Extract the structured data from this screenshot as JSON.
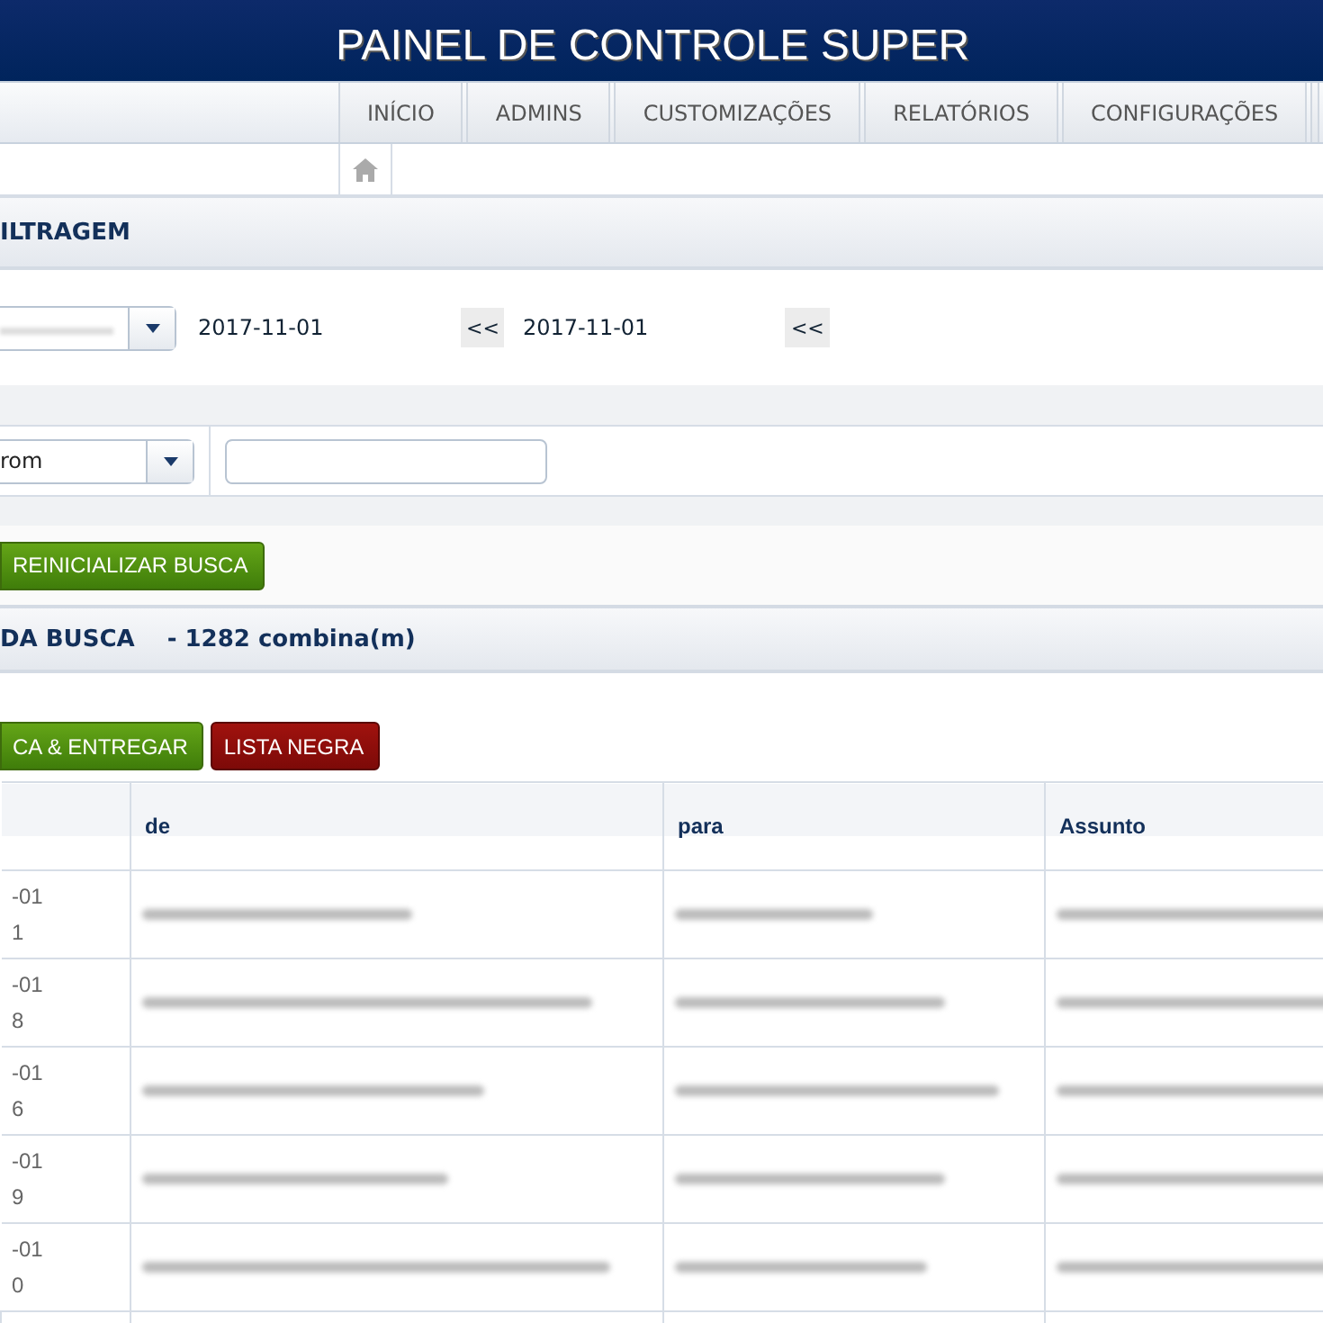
{
  "header": {
    "title": "PAINEL DE CONTROLE SUPER"
  },
  "nav": {
    "tabs": [
      {
        "label": "INÍCIO",
        "selected": false
      },
      {
        "label": "ADMINS",
        "selected": false
      },
      {
        "label": "CUSTOMIZAÇÕES",
        "selected": false
      },
      {
        "label": "RELATÓRIOS",
        "selected": false
      },
      {
        "label": "CONFIGURAÇÕES",
        "selected": false
      }
    ]
  },
  "filter": {
    "title": "ILTRAGEM",
    "date_from": "2017-11-01",
    "date_to": "2017-11-01",
    "prev_button": "<<",
    "field_select": "rom"
  },
  "reset_button": "REINICIALIZAR BUSCA",
  "results": {
    "title": "DA BUSCA",
    "count": "- 1282 combina(m)"
  },
  "actions": [
    {
      "label": "CA & ENTREGAR",
      "kind": "release"
    },
    {
      "label": "LISTA NEGRA",
      "kind": "blacklist"
    }
  ],
  "table": {
    "columns": [
      "",
      "de",
      "para",
      "Assunto"
    ],
    "rows": [
      {
        "date": "-01",
        "time": "1"
      },
      {
        "date": "-01",
        "time": "8"
      },
      {
        "date": "-01",
        "time": "6"
      },
      {
        "date": "-01",
        "time": "9"
      },
      {
        "date": "-01",
        "time": "0"
      }
    ]
  }
}
